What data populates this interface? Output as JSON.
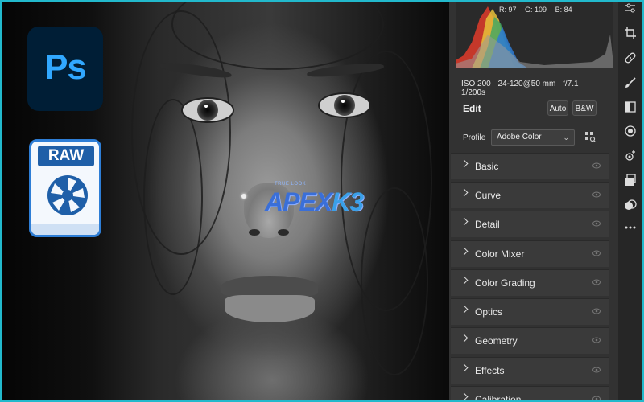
{
  "apps": {
    "photoshop_label": "Ps",
    "raw_label": "RAW"
  },
  "watermark": {
    "brand": "APEX",
    "brand_accent": "K3",
    "tagline": "TRUE LOOK"
  },
  "histogram": {
    "r": "R: 97",
    "g": "G: 109",
    "b": "B: 84"
  },
  "camera_info": {
    "iso": "ISO 200",
    "lens": "24-120@50 mm",
    "aperture": "f/7.1",
    "shutter": "1/200s"
  },
  "edit": {
    "title": "Edit",
    "auto_label": "Auto",
    "bw_label": "B&W",
    "profile_label": "Profile",
    "profile_value": "Adobe Color"
  },
  "sections": [
    {
      "label": "Basic"
    },
    {
      "label": "Curve"
    },
    {
      "label": "Detail"
    },
    {
      "label": "Color Mixer"
    },
    {
      "label": "Color Grading"
    },
    {
      "label": "Optics"
    },
    {
      "label": "Geometry"
    },
    {
      "label": "Effects"
    },
    {
      "label": "Calibration"
    }
  ],
  "tools": [
    "sliders-icon",
    "crop-icon",
    "healing-icon",
    "brush-icon",
    "linear-gradient-icon",
    "radial-filter-icon",
    "red-eye-icon",
    "snapshots-icon",
    "presets-icon",
    "more-icon"
  ],
  "colors": {
    "border": "#22b9cc",
    "panel": "#323232",
    "section": "#3a3a3a",
    "ps_bg": "#001e36",
    "ps_text": "#31a8ff",
    "raw_blue": "#1f5fa8"
  }
}
